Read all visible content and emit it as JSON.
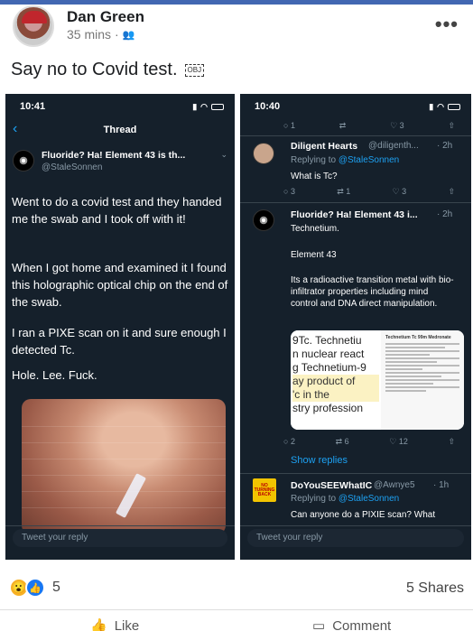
{
  "post": {
    "author": "Dan Green",
    "time": "35 mins",
    "audience_icon": "friends-icon",
    "caption": "Say no to Covid test.",
    "caption_emoji": "OBJ"
  },
  "left_phone": {
    "time": "10:41",
    "title": "Thread",
    "tweet": {
      "name": "Fluoride? Ha! Element 43 is th...",
      "handle": "@StaleSonnen",
      "paragraphs": [
        "Went to do a covid test and they handed me the swab and I took off with it!",
        "When I got home and examined it I found this holographic optical chip on the end of the swab.",
        "I ran a PIXE scan on it and sure enough I detected Tc.",
        "Hole. Lee. Fuck."
      ]
    },
    "reply_placeholder": "Tweet your reply"
  },
  "right_phone": {
    "time": "10:40",
    "top_actions": [
      "1",
      "",
      "3",
      ""
    ],
    "reply1": {
      "name": "Diligent Hearts",
      "handle": "@diligenth...",
      "age": "2h",
      "replying_to_prefix": "Replying to",
      "replying_to": "@StaleSonnen",
      "text": "What is Tc?",
      "actions": [
        "3",
        "1",
        "3",
        ""
      ]
    },
    "reply2": {
      "name": "Fluoride? Ha! Element 43 i...",
      "age": "2h",
      "text_line": "Technetium.",
      "para1": "Element 43",
      "para2": "Its a radioactive transition metal with bio-infiltrator properties including mind control and DNA direct manipulation.",
      "doc_lines": [
        "9Tc. Technetiu",
        "n nuclear react",
        "g Technetium-9",
        "ay product of",
        "'c in the",
        "stry profession"
      ],
      "doc_title": "Technetium Tc 99m Medronate",
      "actions": [
        "2",
        "6",
        "12",
        ""
      ]
    },
    "show_replies": "Show replies",
    "reply3": {
      "name": "DoYouSEEWhatIC",
      "handle": "@Awnye5",
      "age": "1h",
      "replying_to_prefix": "Replying to",
      "replying_to": "@StaleSonnen",
      "text": "Can anyone do a PIXIE scan? What",
      "badge": "NO TURNING BACK"
    },
    "reply_placeholder": "Tweet your reply"
  },
  "footer": {
    "reaction_count": "5",
    "shares": "5 Shares",
    "like_label": "Like",
    "comment_label": "Comment"
  }
}
